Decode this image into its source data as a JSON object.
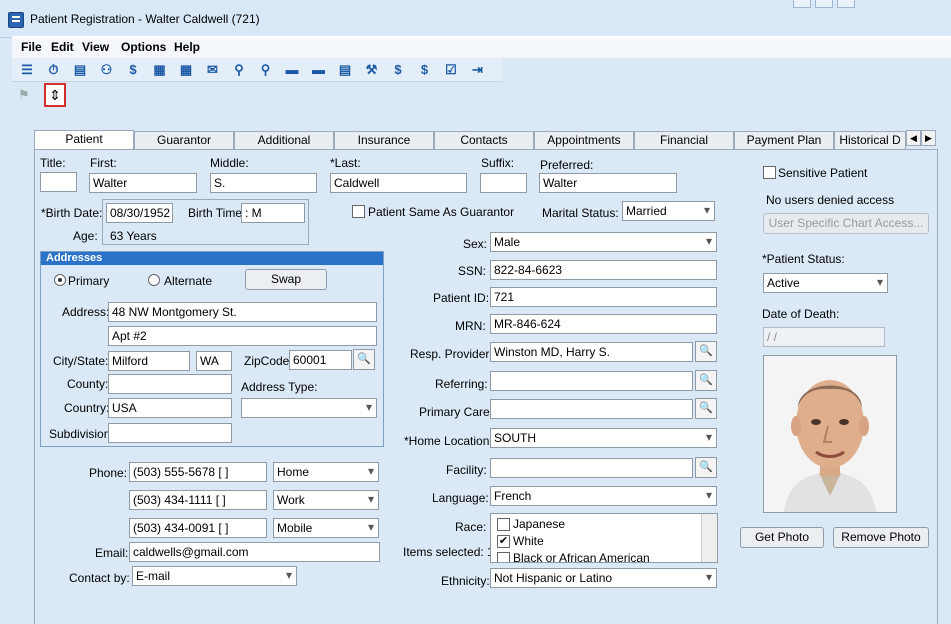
{
  "window": {
    "title": "Patient Registration - Walter Caldwell (721)"
  },
  "menu": [
    "File",
    "Edit",
    "View",
    "Options",
    "Help"
  ],
  "tabs": [
    "Patient",
    "Guarantor",
    "Additional",
    "Insurance",
    "Contacts",
    "Appointments",
    "Financial",
    "Payment Plan",
    "Historical D"
  ],
  "name": {
    "title_label": "Title:",
    "title_value": "",
    "first_label": "First:",
    "first_value": "Walter",
    "middle_label": "Middle:",
    "middle_value": "S.",
    "last_label": "*Last:",
    "last_value": "Caldwell",
    "suffix_label": "Suffix:",
    "suffix_value": "",
    "preferred_label": "Preferred:",
    "preferred_value": "Walter"
  },
  "birth": {
    "date_label": "*Birth Date:",
    "date_value": "08/30/1952",
    "time_label": "Birth Time:",
    "time_value": "  :   M",
    "age_label": "Age:",
    "age_value": "63 Years"
  },
  "same_as_guarantor": "Patient Same As Guarantor",
  "marital": {
    "label": "Marital Status:",
    "value": "Married"
  },
  "addresses": {
    "header": "Addresses",
    "primary": "Primary",
    "alternate": "Alternate",
    "swap": "Swap",
    "address_label": "Address:",
    "address1": "48 NW Montgomery St.",
    "address2": "Apt #2",
    "citystate_label": "City/State:",
    "city": "Milford",
    "state": "WA",
    "zip_label": "ZipCode:",
    "zip": "60001",
    "county_label": "County:",
    "county": "",
    "address_type_label": "Address Type:",
    "address_type": "",
    "country_label": "Country:",
    "country": "USA",
    "subdivision_label": "Subdivision:",
    "subdivision": ""
  },
  "phones": {
    "label": "Phone:",
    "items": [
      {
        "number": "(503) 555-5678 [   ]",
        "type": "Home"
      },
      {
        "number": "(503) 434-1111 [   ]",
        "type": "Work"
      },
      {
        "number": "(503) 434-0091 [   ]",
        "type": "Mobile"
      }
    ]
  },
  "email": {
    "label": "Email:",
    "value": "caldwells@gmail.com"
  },
  "contact_by": {
    "label": "Contact by:",
    "value": "E-mail"
  },
  "mid": {
    "sex_label": "Sex:",
    "sex": "Male",
    "ssn_label": "SSN:",
    "ssn": "822-84-6623",
    "pid_label": "Patient ID:",
    "pid": "721",
    "mrn_label": "MRN:",
    "mrn": "MR-846-624",
    "resp_label": "Resp. Provider:",
    "resp": "Winston MD, Harry S.",
    "referring_label": "Referring:",
    "referring": "",
    "primary_care_label": "Primary Care:",
    "primary_care": "",
    "home_loc_label": "*Home Location:",
    "home_loc": "SOUTH",
    "facility_label": "Facility:",
    "facility": "",
    "language_label": "Language:",
    "language": "French",
    "race_label": "Race:",
    "items_selected": "Items selected: 1",
    "race_options": [
      {
        "label": "Japanese",
        "checked": false
      },
      {
        "label": "White",
        "checked": true
      },
      {
        "label": "Black or African American",
        "checked": false
      }
    ],
    "ethnicity_label": "Ethnicity:",
    "ethnicity": "Not Hispanic or Latino"
  },
  "right": {
    "sensitive": "Sensitive Patient",
    "no_users": "No users denied access",
    "user_access_btn": "User Specific Chart Access...",
    "status_label": "*Patient Status:",
    "status": "Active",
    "death_label": "Date of Death:",
    "death_value": " / /",
    "get_photo": "Get Photo",
    "remove_photo": "Remove Photo"
  },
  "icons": [
    "list-icon",
    "stopwatch-icon",
    "card-icon",
    "people-dollar-icon",
    "dollar-icon",
    "calculator-icon",
    "calculator2-icon",
    "money-icon",
    "search-money-icon",
    "search-dollar-icon",
    "folder-icon",
    "folder-open-icon",
    "document-icon",
    "wrench-icon",
    "dollar-doc-icon",
    "dollar-bars-icon",
    "checklist-icon",
    "exit-icon"
  ],
  "toolbar_glyphs": [
    "☰",
    "⏱",
    "▤",
    "⚇",
    "$",
    "▦",
    "▦",
    "✉",
    "⚲",
    "⚲",
    "▬",
    "▬",
    "▤",
    "⚒",
    "$",
    "$",
    "☑",
    "⇥"
  ],
  "colors": {
    "accent": "#2a73c8",
    "highlight": "#d0312d"
  }
}
